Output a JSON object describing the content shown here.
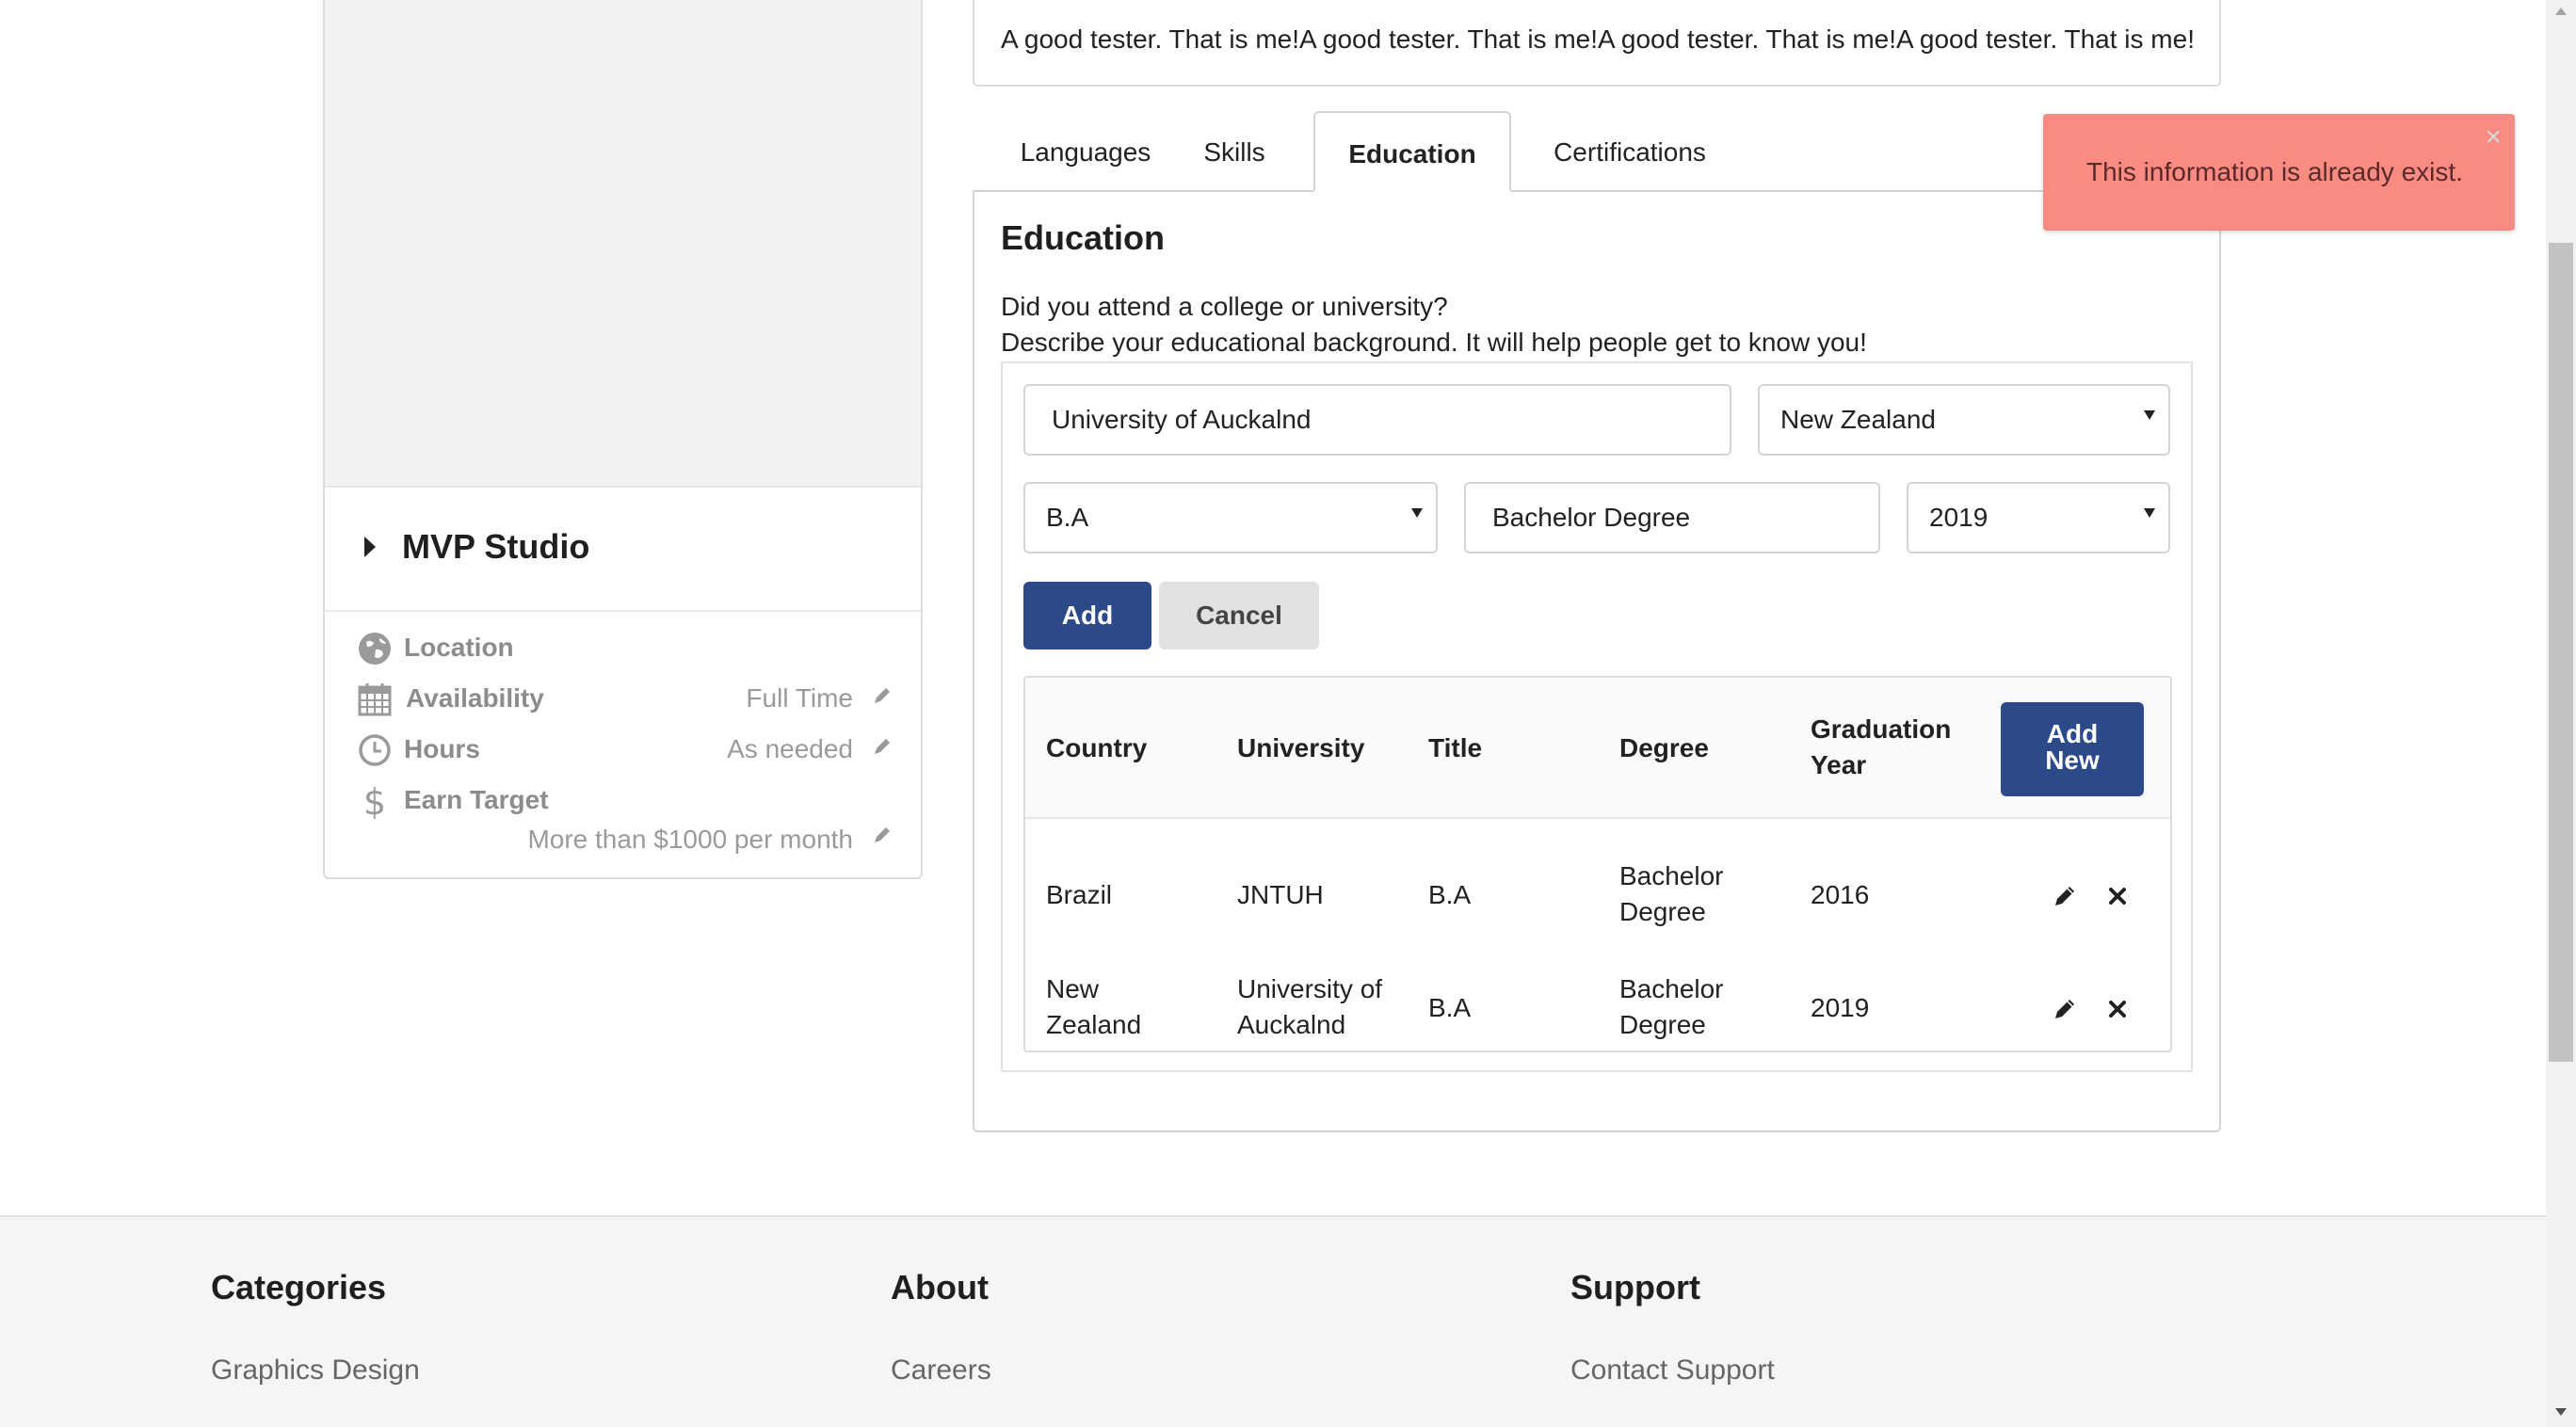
{
  "profile": {
    "description": "A good tester. That is me!A good tester. That is me!A good tester. That is me!A good tester. That is me!",
    "company_name": "MVP Studio",
    "location_label": "Location",
    "availability_label": "Availability",
    "availability_value": "Full Time",
    "hours_label": "Hours",
    "hours_value": "As needed",
    "earn_target_label": "Earn Target",
    "earn_target_value": "More than $1000 per month"
  },
  "tabs": [
    {
      "label": "Languages",
      "active": false
    },
    {
      "label": "Skills",
      "active": false
    },
    {
      "label": "Education",
      "active": true
    },
    {
      "label": "Certifications",
      "active": false
    }
  ],
  "education": {
    "title": "Education",
    "question": "Did you attend a college or university?",
    "subtext": "Describe your educational background. It will help people get to know you!",
    "form": {
      "university": "University of Auckalnd",
      "country": "New Zealand",
      "title": "B.A",
      "degree": "Bachelor Degree",
      "year": "2019",
      "add_label": "Add",
      "cancel_label": "Cancel"
    },
    "table": {
      "headers": {
        "country": "Country",
        "university": "University",
        "title": "Title",
        "degree": "Degree",
        "graduation_year_line1": "Graduation",
        "graduation_year_line2": "Year"
      },
      "add_new_line1": "Add",
      "add_new_line2": "New",
      "rows": [
        {
          "country_l1": "Brazil",
          "country_l2": "",
          "university_l1": "JNTUH",
          "university_l2": "",
          "title": "B.A",
          "degree_l1": "Bachelor",
          "degree_l2": "Degree",
          "year": "2016"
        },
        {
          "country_l1": "New",
          "country_l2": "Zealand",
          "university_l1": "University of",
          "university_l2": "Auckalnd",
          "title": "B.A",
          "degree_l1": "Bachelor",
          "degree_l2": "Degree",
          "year": "2019"
        }
      ]
    }
  },
  "toast": {
    "message": "This information is already exist.",
    "close_symbol": "×",
    "color": "#f98b82"
  },
  "footer": {
    "categories_title": "Categories",
    "categories_link": "Graphics Design",
    "about_title": "About",
    "about_link": "Careers",
    "support_title": "Support",
    "support_link": "Contact Support"
  },
  "colors": {
    "primary": "#2c4a8a",
    "secondary": "#e0e1e2"
  },
  "icons": {
    "location": "globe-icon",
    "availability": "calendar-icon",
    "hours": "clock-icon",
    "earn_target": "dollar-icon",
    "edit": "pencil-icon",
    "delete": "close-icon"
  }
}
